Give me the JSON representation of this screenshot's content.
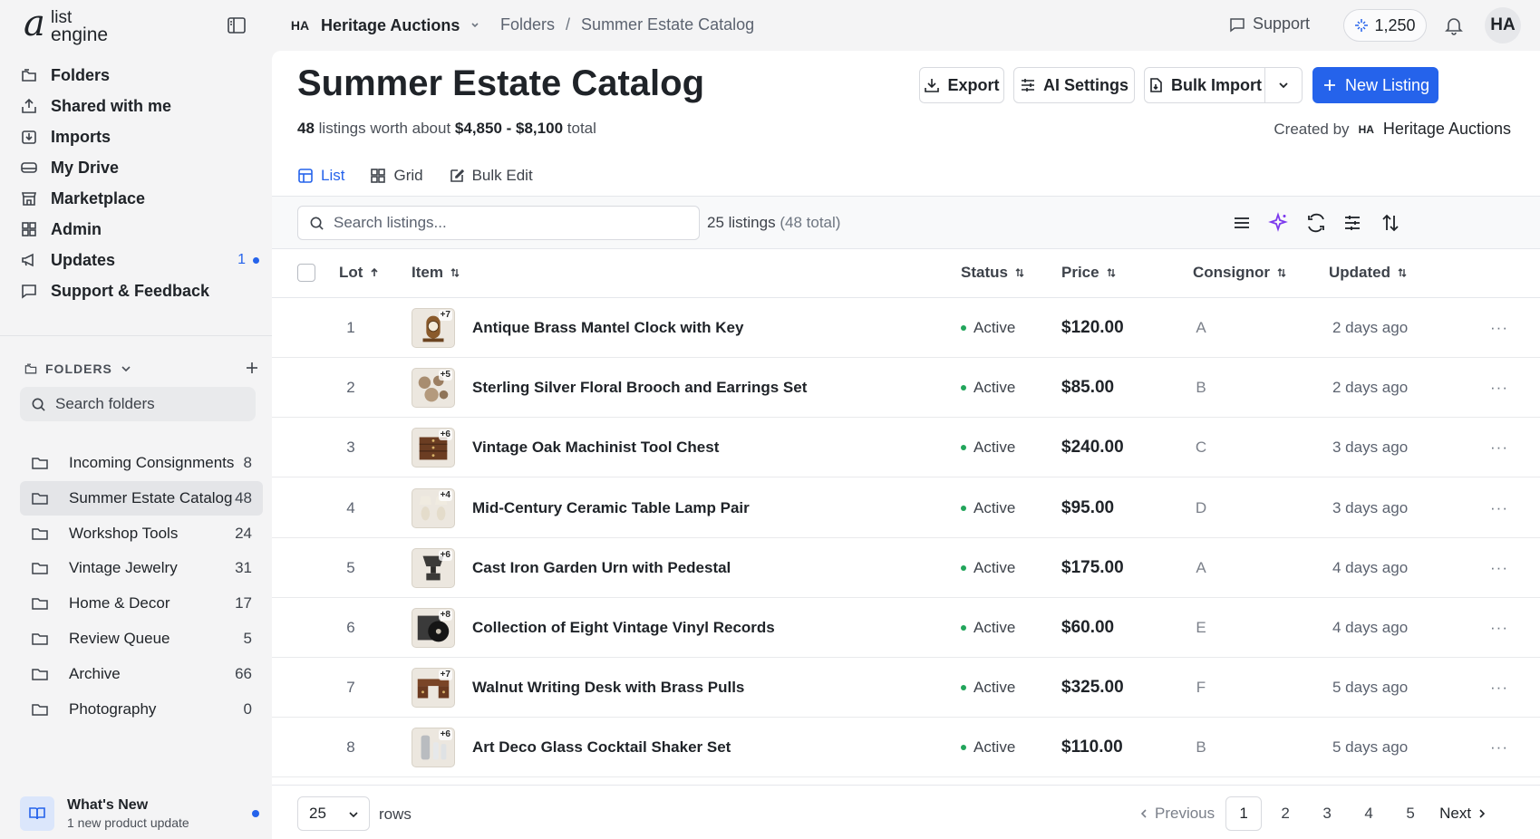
{
  "logo": {
    "letter": "a",
    "line1": "list",
    "line2": "engine"
  },
  "workspace": {
    "badge": "HA",
    "name": "Heritage Auctions"
  },
  "breadcrumb": {
    "root": "Folders",
    "sep": "/",
    "current": "Summer Estate Catalog"
  },
  "topbar": {
    "support_label": "Support",
    "credits": "1,250",
    "avatar": "HA"
  },
  "sidebar": {
    "items": [
      {
        "label": "Folders",
        "icon": "folders-icon"
      },
      {
        "label": "Shared with me",
        "icon": "share-icon"
      },
      {
        "label": "Imports",
        "icon": "import-icon"
      },
      {
        "label": "My Drive",
        "icon": "drive-icon"
      },
      {
        "label": "Marketplace",
        "icon": "store-icon"
      },
      {
        "label": "Admin",
        "icon": "grid-icon"
      },
      {
        "label": "Updates",
        "icon": "megaphone-icon",
        "badge": "1"
      },
      {
        "label": "Support & Feedback",
        "icon": "chat-icon"
      }
    ],
    "folders_heading": "FOLDERS",
    "folder_search_placeholder": "Search folders",
    "folders": [
      {
        "name": "Incoming Consignments",
        "count": "8"
      },
      {
        "name": "Summer Estate Catalog",
        "count": "48",
        "active": true
      },
      {
        "name": "Workshop Tools",
        "count": "24"
      },
      {
        "name": "Vintage Jewelry",
        "count": "31"
      },
      {
        "name": "Home & Decor",
        "count": "17"
      },
      {
        "name": "Review Queue",
        "count": "5"
      },
      {
        "name": "Archive",
        "count": "66"
      },
      {
        "name": "Photography",
        "count": "0"
      }
    ],
    "whats_new": {
      "title": "What's New",
      "subtitle": "1 new product update"
    }
  },
  "page": {
    "title": "Summer Estate Catalog",
    "sub_count": "48",
    "sub_mid": "listings worth about",
    "sub_range": "$4,850 - $8,100",
    "sub_tail": "total",
    "created_by_label": "Created by",
    "created_by_badge": "HA",
    "created_by_name": "Heritage Auctions"
  },
  "actions": {
    "export": "Export",
    "ai_settings": "AI Settings",
    "bulk_import": "Bulk Import",
    "new_listing": "New Listing"
  },
  "tabs": [
    {
      "label": "List",
      "active": true
    },
    {
      "label": "Grid"
    },
    {
      "label": "Bulk Edit"
    }
  ],
  "search": {
    "placeholder": "Search listings..."
  },
  "listing_count": {
    "shown": "25 listings",
    "total": "(48 total)"
  },
  "table": {
    "columns": {
      "lot": "Lot",
      "item": "Item",
      "status": "Status",
      "price": "Price",
      "consignor": "Consignor",
      "updated": "Updated"
    },
    "rows": [
      {
        "lot": "1",
        "extra": "+7",
        "item": "Antique Brass Mantel Clock with Key",
        "status": "Active",
        "price": "$120.00",
        "consignor": "A",
        "updated": "2 days ago",
        "thumb": "clock"
      },
      {
        "lot": "2",
        "extra": "+5",
        "item": "Sterling Silver Floral Brooch and Earrings Set",
        "status": "Active",
        "price": "$85.00",
        "consignor": "B",
        "updated": "2 days ago",
        "thumb": "brooch"
      },
      {
        "lot": "3",
        "extra": "+6",
        "item": "Vintage Oak Machinist Tool Chest",
        "status": "Active",
        "price": "$240.00",
        "consignor": "C",
        "updated": "3 days ago",
        "thumb": "chest"
      },
      {
        "lot": "4",
        "extra": "+4",
        "item": "Mid-Century Ceramic Table Lamp Pair",
        "status": "Active",
        "price": "$95.00",
        "consignor": "D",
        "updated": "3 days ago",
        "thumb": "lamp"
      },
      {
        "lot": "5",
        "extra": "+6",
        "item": "Cast Iron Garden Urn with Pedestal",
        "status": "Active",
        "price": "$175.00",
        "consignor": "A",
        "updated": "4 days ago",
        "thumb": "urn"
      },
      {
        "lot": "6",
        "extra": "+8",
        "item": "Collection of Eight Vintage Vinyl Records",
        "status": "Active",
        "price": "$60.00",
        "consignor": "E",
        "updated": "4 days ago",
        "thumb": "vinyl"
      },
      {
        "lot": "7",
        "extra": "+7",
        "item": "Walnut Writing Desk with Brass Pulls",
        "status": "Active",
        "price": "$325.00",
        "consignor": "F",
        "updated": "5 days ago",
        "thumb": "desk"
      },
      {
        "lot": "8",
        "extra": "+6",
        "item": "Art Deco Glass Cocktail Shaker Set",
        "status": "Active",
        "price": "$110.00",
        "consignor": "B",
        "updated": "5 days ago",
        "thumb": "shaker"
      }
    ]
  },
  "footer": {
    "rows_value": "25",
    "rows_label": "rows",
    "prev": "Previous",
    "next": "Next",
    "pages": [
      "1",
      "2",
      "3",
      "4",
      "5"
    ],
    "current_page": "1"
  },
  "colors": {
    "accent": "#2563eb",
    "status_active": "#22a55b",
    "ai_purple": "#7c3aed"
  }
}
